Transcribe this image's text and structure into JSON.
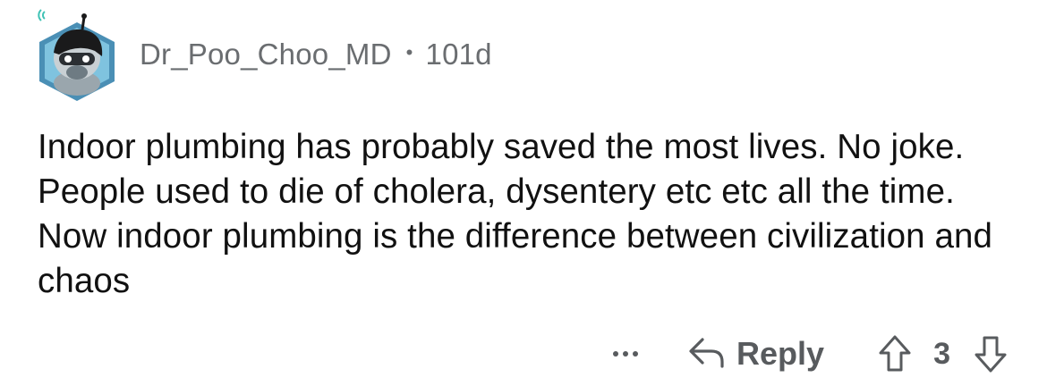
{
  "comment": {
    "author": "Dr_Poo_Choo_MD",
    "separator": "•",
    "age": "101d",
    "body": "Indoor plumbing has probably saved the most lives. No joke. People used to die of cholera, dysentery etc etc all the time. Now indoor plumbing is the difference between civilization and chaos"
  },
  "actions": {
    "more_icon": "ellipsis-icon",
    "reply_icon": "reply-arrow-icon",
    "reply_label": "Reply",
    "upvote_icon": "upvote-arrow-icon",
    "score": "3",
    "downvote_icon": "downvote-arrow-icon"
  },
  "colors": {
    "meta_text": "#6a6d70",
    "body_text": "#111111",
    "action_text": "#585b5e",
    "avatar_bg": "#4a8fb5"
  }
}
